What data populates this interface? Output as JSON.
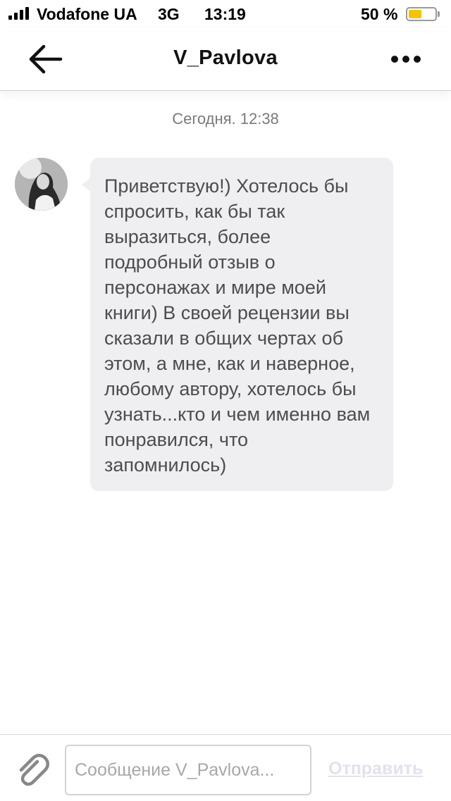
{
  "status_bar": {
    "carrier": "Vodafone UA",
    "network": "3G",
    "time": "13:19",
    "battery_percent_label": "50 %",
    "battery_level": 0.5,
    "battery_color": "#f5c400"
  },
  "header": {
    "title": "V_Pavlova",
    "back_icon": "arrow-left-icon",
    "more_icon": "ellipsis-icon"
  },
  "conversation": {
    "date_stamp": "Сегодня. 12:38",
    "messages": [
      {
        "sender": "V_Pavlova",
        "text": "Приветствую!) Хотелось бы\nспросить, как бы так\nвыразиться, более\nподробный отзыв о\nперсонажах и мире моей\nкниги) В своей рецензии вы\nсказали в общих чертах об\nэтом, а мне, как и наверное,\nлюбому автору, хотелось бы\nузнать...кто и чем именно вам\nпонравился, что\nзапомнилось)"
      }
    ]
  },
  "composer": {
    "attach_icon": "paperclip-icon",
    "placeholder": "Сообщение V_Pavlova...",
    "value": "",
    "send_label": "Отправить"
  },
  "colors": {
    "bubble_bg": "#efeef1",
    "send_disabled": "#e3e1ee"
  }
}
